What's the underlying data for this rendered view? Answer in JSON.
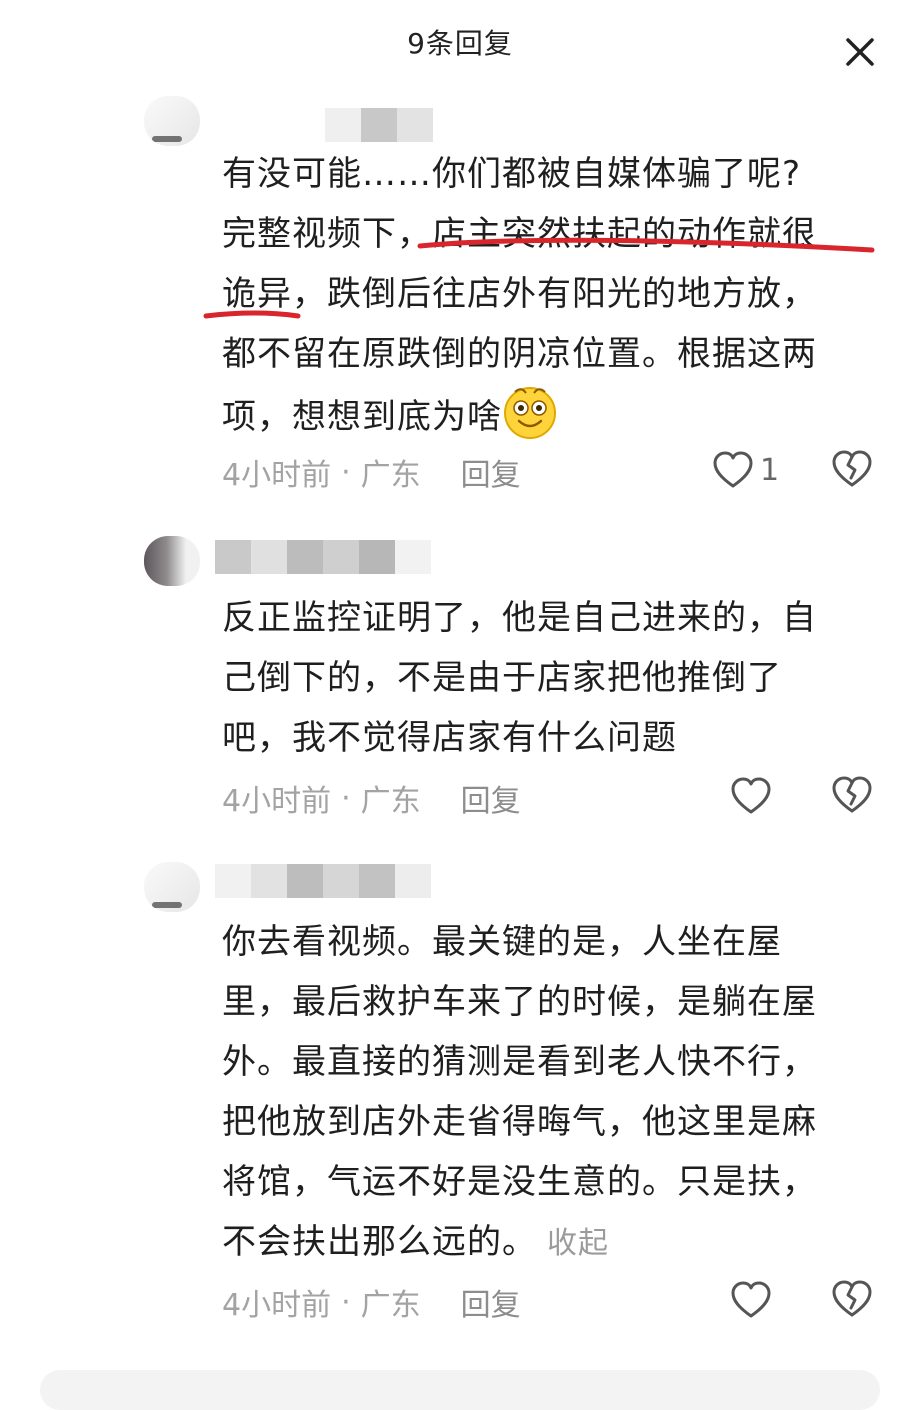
{
  "header": {
    "title": "9条回复"
  },
  "comments": [
    {
      "line1": "有没可能……你们都被自媒体骗了呢?",
      "line2_a": "完整视频下，",
      "line2_b": "店主突然扶起的动作就很",
      "line3_a": "诡异",
      "line3_b": "，跌倒后往店外有阳光的地方放，",
      "line4": "都不留在原跌倒的阴凉位置。根据这两",
      "line5": "项，想想到底为啥",
      "time": "4小时前",
      "region": "广东",
      "sep": "·",
      "reply": "回复",
      "likes": "1"
    },
    {
      "line1": "反正监控证明了，他是自己进来的，自",
      "line2": "己倒下的，不是由于店家把他推倒了",
      "line3": "吧，我不觉得店家有什么问题",
      "time": "4小时前",
      "region": "广东",
      "sep": "·",
      "reply": "回复"
    },
    {
      "line1": "你去看视频。最关键的是，人坐在屋",
      "line2": "里，最后救护车来了的时候，是躺在屋",
      "line3": "外。最直接的猜测是看到老人快不行，",
      "line4": "把他放到店外走省得晦气，他这里是麻",
      "line5": "将馆，气运不好是没生意的。只是扶，",
      "line6": "不会扶出那么远的。",
      "collapse": "收起",
      "time": "4小时前",
      "region": "广东",
      "sep": "·",
      "reply": "回复"
    }
  ],
  "colors": {
    "underline": "#d9262c",
    "meta": "#a3a3a3",
    "icon": "#555555"
  }
}
